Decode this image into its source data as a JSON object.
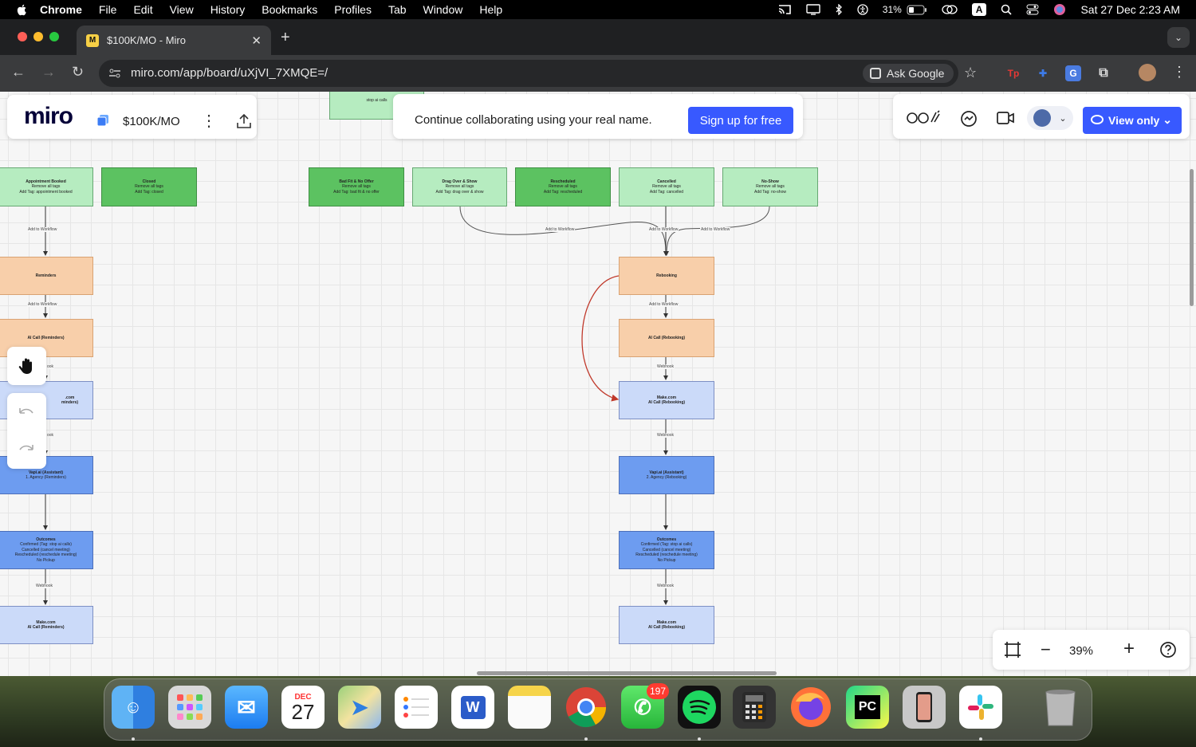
{
  "menubar": {
    "app": "Chrome",
    "items": [
      "File",
      "Edit",
      "View",
      "History",
      "Bookmarks",
      "Profiles",
      "Tab",
      "Window",
      "Help"
    ],
    "battery": "31%",
    "input_source": "A",
    "clock": "Sat 27 Dec  2:23 AM"
  },
  "browser": {
    "tab_title": "$100K/MO - Miro",
    "tab_favicon": "M",
    "url": "miro.com/app/board/uXjVI_7XMQE=/",
    "ask_google": "Ask Google",
    "ext_tp": "Tp"
  },
  "miro": {
    "logo": "miro",
    "board_name": "$100K/MO",
    "banner_text": "Continue collaborating using your real name.",
    "signup_label": "Sign up for free",
    "view_only_label": "View only",
    "zoom": "39%"
  },
  "board": {
    "top_partial_node": "stop ai calls",
    "left_column": {
      "appointment_booked": {
        "title": "Appointment Booked",
        "lines": [
          "Remove all tags",
          "Add Tag: appointment booked"
        ]
      },
      "closed": {
        "title": "Closed",
        "lines": [
          "Remove all tags",
          "Add Tag: closed"
        ]
      },
      "reminders": {
        "title": "Reminders"
      },
      "ai_call_reminders": {
        "title": "AI Call (Reminders)"
      },
      "make_reminders_partial": {
        "title": ".com",
        "sub": "minders)"
      },
      "vapi_reminders": {
        "title": "Vapi.ai (Assistant)",
        "sub": "1. Agency (Reminders)"
      },
      "outcomes_left": {
        "title": "Outcomes",
        "lines": [
          "Confirmed (Tag: stop ai calls)",
          "Cancelled (cancel meeting)",
          "Rescheduled (reschedule meeting)",
          "No Pickup"
        ]
      },
      "make_reminders": {
        "title": "Make.com",
        "sub": "AI Call (Reminders)"
      },
      "label_add_workflow_1": "Add to Workflow",
      "label_add_workflow_2": "Add to Workflow",
      "label_webhook_1": "ook",
      "label_webhook_2": "ook",
      "label_webhook_3": "Webhook"
    },
    "right_column": {
      "bad_fit": {
        "title": "Bad Fit & No Offer",
        "lines": [
          "Remove all tags",
          "Add Tag: bad fit & no offer"
        ]
      },
      "drag_over": {
        "title": "Drag Over & Show",
        "lines": [
          "Remove all tags",
          "Add Tag: drag over & show"
        ]
      },
      "rescheduled": {
        "title": "Rescheduled",
        "lines": [
          "Remove all tags",
          "Add Tag: rescheduled"
        ]
      },
      "cancelled": {
        "title": "Cancelled",
        "lines": [
          "Remove all tags",
          "Add Tag: cancelled"
        ]
      },
      "no_show": {
        "title": "No-Show",
        "lines": [
          "Remove all tags",
          "Add Tag: no-show"
        ]
      },
      "rebooking": {
        "title": "Rebooking"
      },
      "ai_call_rebooking": {
        "title": "AI Call (Rebooking)"
      },
      "make_rebooking_1": {
        "title": "Make.com",
        "sub": "AI Call (Rebooking)"
      },
      "vapi_rebooking": {
        "title": "Vapi.ai (Assistant)",
        "sub": "2. Agency (Rebooking)"
      },
      "outcomes_right": {
        "title": "Outcomes",
        "lines": [
          "Confirmed (Tag: stop ai calls)",
          "Cancelled (cancel meeting)",
          "Rescheduled (reschedule meeting)",
          "No Pickup"
        ]
      },
      "make_rebooking_2": {
        "title": "Make.com",
        "sub": "AI Call (Rebooking)"
      },
      "label_add_workflow_a": "Add to Workflow",
      "label_add_workflow_b": "Add to Workflow",
      "label_add_workflow_c": "Add to Workflow",
      "label_add_workflow_d": "Add to Workflow",
      "label_webhook_a": "Webhook",
      "label_webhook_b": "Webhook",
      "label_webhook_c": "Webhook"
    }
  },
  "dock": {
    "calendar_month": "DEC",
    "calendar_day": "27",
    "whatsapp_badge": "197",
    "pycharm_label": "PC"
  },
  "colors": {
    "accent": "#3859ff",
    "green_dark": "#5cc261",
    "green_light": "#b6ecc0",
    "orange": "#f8cfaa",
    "blue_light": "#cbdaf9",
    "blue": "#6d9cf0",
    "rebook_arrow": "#c0392b"
  }
}
